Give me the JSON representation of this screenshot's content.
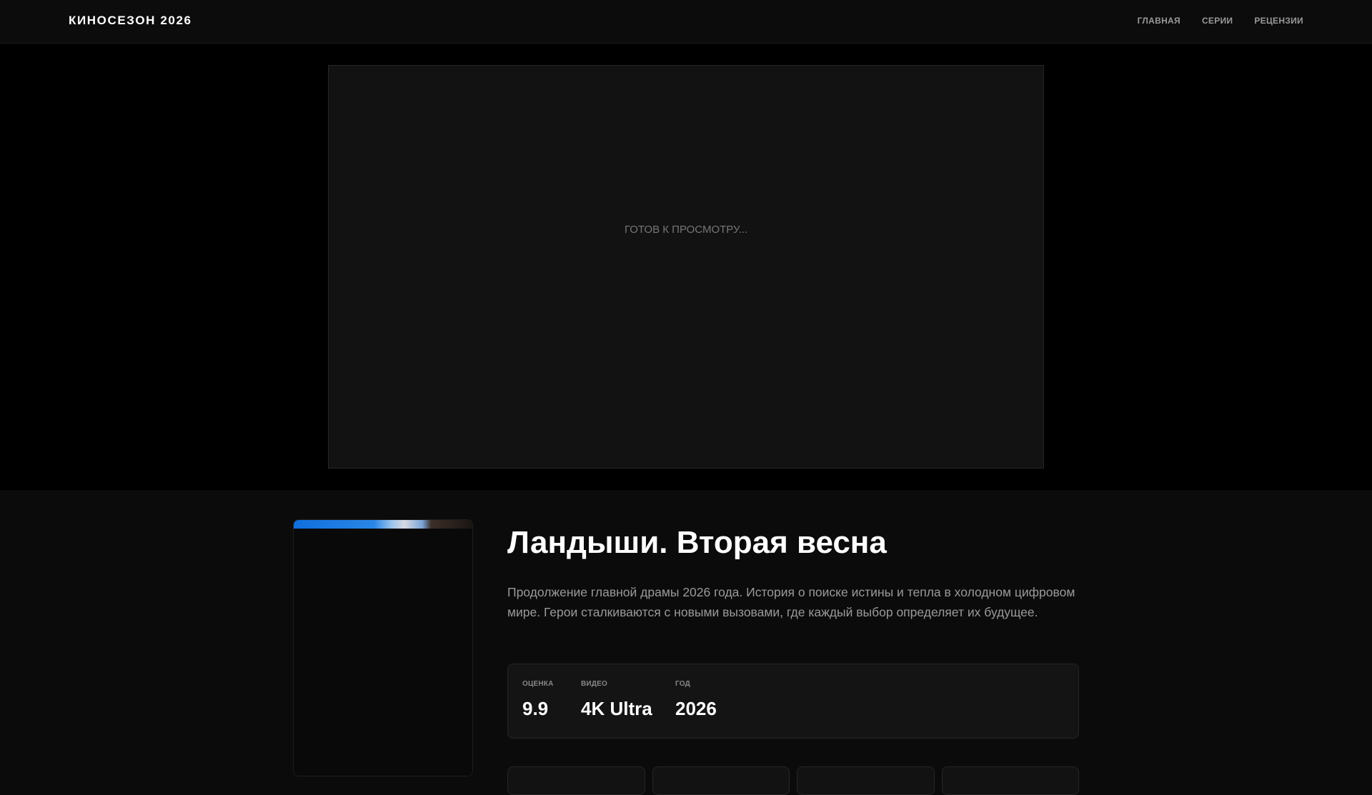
{
  "header": {
    "logo": "КИНОСЕЗОН 2026",
    "nav": [
      "ГЛАВНАЯ",
      "СЕРИИ",
      "РЕЦЕНЗИИ"
    ]
  },
  "player": {
    "status": "ГОТОВ К ПРОСМОТРУ..."
  },
  "movie": {
    "title": "Ландыши. Вторая весна",
    "description": "Продолжение главной драмы 2026 года. История о поиске истины и тепла в холодном цифровом мире. Герои сталкиваются с новыми вызовами, где каждый выбор определяет их будущее.",
    "stats": [
      {
        "label": "ОЦЕНКА",
        "value": "9.9"
      },
      {
        "label": "ВИДЕО",
        "value": "4K Ultra"
      },
      {
        "label": "ГОД",
        "value": "2026"
      }
    ]
  }
}
